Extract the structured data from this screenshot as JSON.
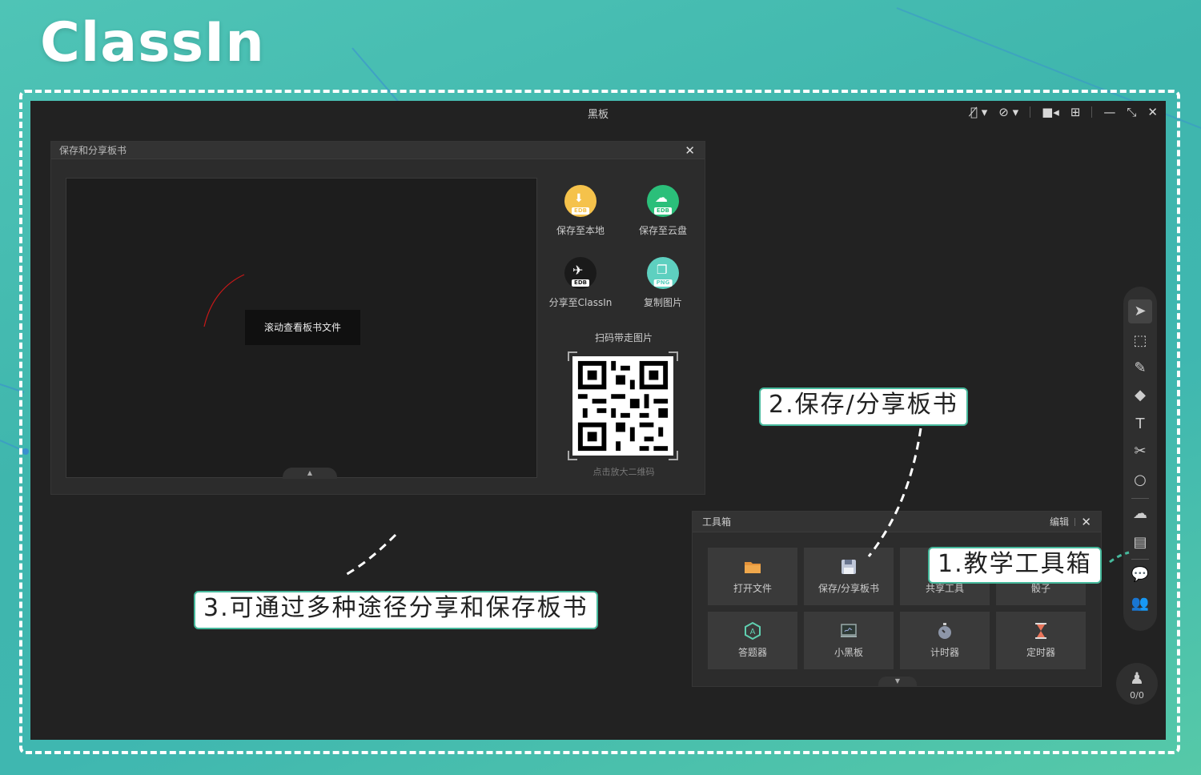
{
  "brand": {
    "logo_text": "ClassIn"
  },
  "app": {
    "title": "黑板",
    "save_dialog": {
      "title": "保存和分享板书",
      "tooltip": "滚动查看板书文件",
      "actions": [
        {
          "label": "保存至本地",
          "icon": "save-local-icon",
          "tag": "EDB",
          "color": "#f5c24b"
        },
        {
          "label": "保存至云盘",
          "icon": "cloud-save-icon",
          "tag": "EDB",
          "color": "#2bbf7a"
        },
        {
          "label": "分享至ClassIn",
          "icon": "classin-share-icon",
          "tag": "EDB",
          "color": "#1a1a1a"
        },
        {
          "label": "复制图片",
          "icon": "copy-image-icon",
          "tag": "PNG",
          "color": "#5ed0c0"
        }
      ],
      "qr_title": "扫码带走图片",
      "qr_hint": "点击放大二维码"
    },
    "toolbox": {
      "title": "工具箱",
      "edit_label": "编辑",
      "tools": [
        {
          "label": "打开文件",
          "icon": "folder-icon"
        },
        {
          "label": "保存/分享板书",
          "icon": "floppy-icon"
        },
        {
          "label": "共享工具",
          "icon": "share-tool-icon"
        },
        {
          "label": "骰子",
          "icon": "dice-icon"
        },
        {
          "label": "答题器",
          "icon": "answer-icon"
        },
        {
          "label": "小黑板",
          "icon": "mini-blackboard-icon"
        },
        {
          "label": "计时器",
          "icon": "stopwatch-icon"
        },
        {
          "label": "定时器",
          "icon": "hourglass-icon"
        }
      ]
    },
    "seat_count": "0/0"
  },
  "callouts": {
    "c1": "1.教学工具箱",
    "c2": "2.保存/分享板书",
    "c3": "3.可通过多种途径分享和保存板书"
  },
  "colors": {
    "accent": "#46b99c",
    "bg_teal": "#3fb6ad",
    "panel": "#2c2c2c"
  }
}
